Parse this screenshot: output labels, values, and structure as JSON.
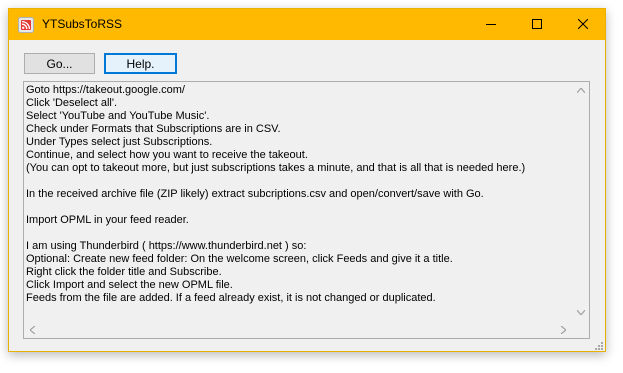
{
  "window": {
    "title": "YTSubsToRSS",
    "titlebar_color": "#ffb900",
    "app_icon": "rss-feed-icon",
    "controls": {
      "minimize_icon": "minimize-icon",
      "maximize_icon": "maximize-icon",
      "close_icon": "close-icon"
    }
  },
  "toolbar": {
    "go_label": "Go...",
    "help_label": "Help."
  },
  "instructions": {
    "lines": [
      "Goto https://takeout.google.com/",
      "Click 'Deselect all'.",
      "Select 'YouTube and YouTube Music'.",
      "Check under Formats that Subscriptions are in CSV.",
      "Under Types select just Subscriptions.",
      "Continue, and select how you want to receive the takeout.",
      "(You can opt to takeout more, but just subscriptions takes a minute, and that is all that is needed here.)",
      "",
      "In the received archive file (ZIP likely) extract subcriptions.csv and open/convert/save with Go.",
      "",
      "Import OPML in your feed reader.",
      "",
      "I am using Thunderbird ( https://www.thunderbird.net ) so:",
      "Optional: Create new feed folder: On the welcome screen, click Feeds and give it a title.",
      "Right click the folder title and Subscribe.",
      "Click Import and select the new OPML file.",
      "Feeds from the file are added. If a feed already exist, it is not changed or duplicated."
    ]
  }
}
